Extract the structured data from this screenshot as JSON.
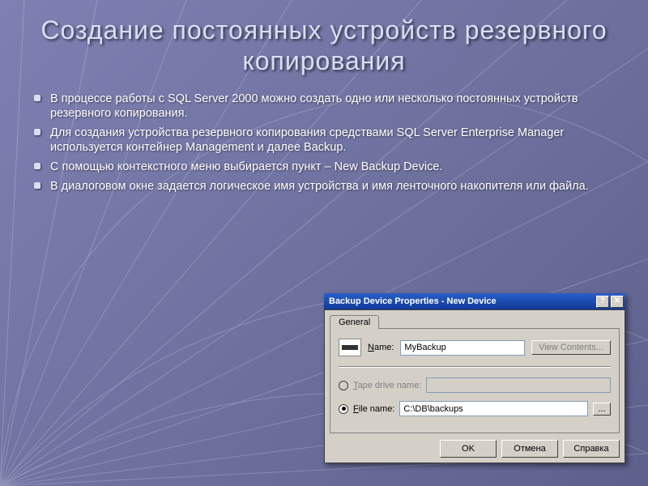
{
  "title": "Создание постоянных устройств резервного копирования",
  "bullets": [
    "В процессе работы с SQL Server 2000 можно создать одно или несколько постоянных устройств резервного копирования.",
    "Для создания устройства резервного копирования средствами SQL Server Enterprise Manager используется контейнер Management и далее Backup.",
    "С помощью контекстного меню выбирается пункт – New Backup Device.",
    "В диалоговом окне задается логическое имя устройства и имя ленточного накопителя или файла."
  ],
  "dialog": {
    "title": "Backup Device Properties - New Device",
    "tab": "General",
    "name_label": "Name:",
    "name_value": "MyBackup",
    "view_contents": "View Contents...",
    "tape_label": "Tape drive name:",
    "file_label": "File name:",
    "file_value": "C:\\DB\\backups",
    "browse": "...",
    "ok": "OK",
    "cancel": "Отмена",
    "help": "Справка",
    "close_glyph": "✕",
    "help_glyph": "?"
  }
}
